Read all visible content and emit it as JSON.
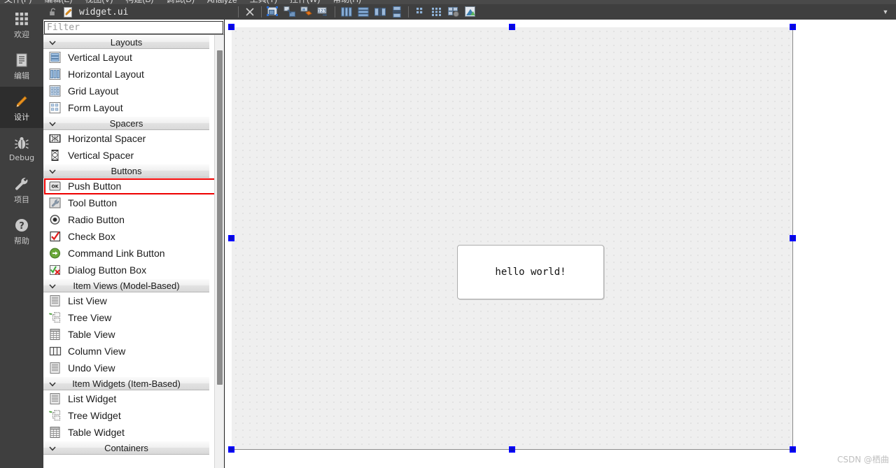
{
  "menubar": {
    "items": [
      "文件(F)",
      "编辑(E)",
      "视图(V)",
      "构建(B)",
      "调试(D)",
      "Analyze",
      "工具(T)",
      "控件(W)",
      "帮助(H)"
    ]
  },
  "modebar": {
    "items": [
      {
        "label": "欢迎",
        "icon": "grid-icon",
        "active": false
      },
      {
        "label": "编辑",
        "icon": "document-icon",
        "active": false
      },
      {
        "label": "设计",
        "icon": "pencil-icon",
        "active": true
      },
      {
        "label": "Debug",
        "icon": "bug-icon",
        "active": false
      },
      {
        "label": "项目",
        "icon": "wrench-icon",
        "active": false
      },
      {
        "label": "帮助",
        "icon": "question-icon",
        "active": false
      }
    ]
  },
  "docbar": {
    "lock_icon": "unlocked-padlock-icon",
    "file_icon": "ui-file-icon",
    "filename": "widget.ui",
    "caret_icon": "chevron-down-icon"
  },
  "designer_toolbar": {
    "buttons": [
      {
        "name": "close-document-button",
        "icon": "close-x-icon"
      },
      {
        "name": "edit-widgets-button",
        "icon": "edit-widgets-icon"
      },
      {
        "name": "edit-signals-slots-button",
        "icon": "signals-slots-icon"
      },
      {
        "name": "edit-buddies-button",
        "icon": "buddies-icon"
      },
      {
        "name": "edit-tab-order-button",
        "icon": "tab-order-icon"
      },
      {
        "name": "layout-horizontally-button",
        "icon": "layout-horizontal-icon"
      },
      {
        "name": "layout-vertically-button",
        "icon": "layout-vertical-icon"
      },
      {
        "name": "layout-horizontally-in-splitter-button",
        "icon": "splitter-horizontal-icon"
      },
      {
        "name": "layout-vertically-in-splitter-button",
        "icon": "splitter-vertical-icon"
      },
      {
        "name": "layout-in-form-button",
        "icon": "form-layout-icon"
      },
      {
        "name": "layout-in-grid-button",
        "icon": "grid-layout-icon"
      },
      {
        "name": "break-layout-button",
        "icon": "break-layout-icon"
      },
      {
        "name": "adjust-size-button",
        "icon": "adjust-size-icon"
      }
    ]
  },
  "widgetbox": {
    "filter": {
      "value": "",
      "placeholder": "Filter"
    },
    "scrollbar": {
      "name": "widgetbox-scrollbar"
    },
    "categories": [
      {
        "title": "Layouts",
        "expanded": true,
        "items": [
          {
            "label": "Vertical Layout",
            "icon": "vertical-layout-icon"
          },
          {
            "label": "Horizontal Layout",
            "icon": "horizontal-layout-icon"
          },
          {
            "label": "Grid Layout",
            "icon": "grid-layout-icon"
          },
          {
            "label": "Form Layout",
            "icon": "form-layout-icon"
          }
        ]
      },
      {
        "title": "Spacers",
        "expanded": true,
        "items": [
          {
            "label": "Horizontal Spacer",
            "icon": "horizontal-spacer-icon"
          },
          {
            "label": "Vertical Spacer",
            "icon": "vertical-spacer-icon"
          }
        ]
      },
      {
        "title": "Buttons",
        "expanded": true,
        "items": [
          {
            "label": "Push Button",
            "icon": "push-button-icon",
            "highlighted": true
          },
          {
            "label": "Tool Button",
            "icon": "tool-button-icon"
          },
          {
            "label": "Radio Button",
            "icon": "radio-button-icon"
          },
          {
            "label": "Check Box",
            "icon": "check-box-icon"
          },
          {
            "label": "Command Link Button",
            "icon": "command-link-icon"
          },
          {
            "label": "Dialog Button Box",
            "icon": "dialog-button-box-icon"
          }
        ]
      },
      {
        "title": "Item Views (Model-Based)",
        "expanded": true,
        "items": [
          {
            "label": "List View",
            "icon": "list-view-icon"
          },
          {
            "label": "Tree View",
            "icon": "tree-view-icon"
          },
          {
            "label": "Table View",
            "icon": "table-view-icon"
          },
          {
            "label": "Column View",
            "icon": "column-view-icon"
          },
          {
            "label": "Undo View",
            "icon": "undo-view-icon"
          }
        ]
      },
      {
        "title": "Item Widgets (Item-Based)",
        "expanded": true,
        "items": [
          {
            "label": "List Widget",
            "icon": "list-widget-icon"
          },
          {
            "label": "Tree Widget",
            "icon": "tree-widget-icon"
          },
          {
            "label": "Table Widget",
            "icon": "table-widget-icon"
          }
        ]
      },
      {
        "title": "Containers",
        "expanded": true,
        "items": []
      }
    ],
    "highlight_color": "#ee0000"
  },
  "form_editor": {
    "selected_widget": "form-canvas",
    "selection_handle_color": "#0000ff",
    "canvas": {
      "grid": "dots",
      "grid_spacing": 10
    },
    "widgets": [
      {
        "name": "push-button-hello",
        "type": "QPushButton",
        "text": "hello world!"
      }
    ]
  },
  "watermark": {
    "text": "CSDN @栖曲"
  }
}
